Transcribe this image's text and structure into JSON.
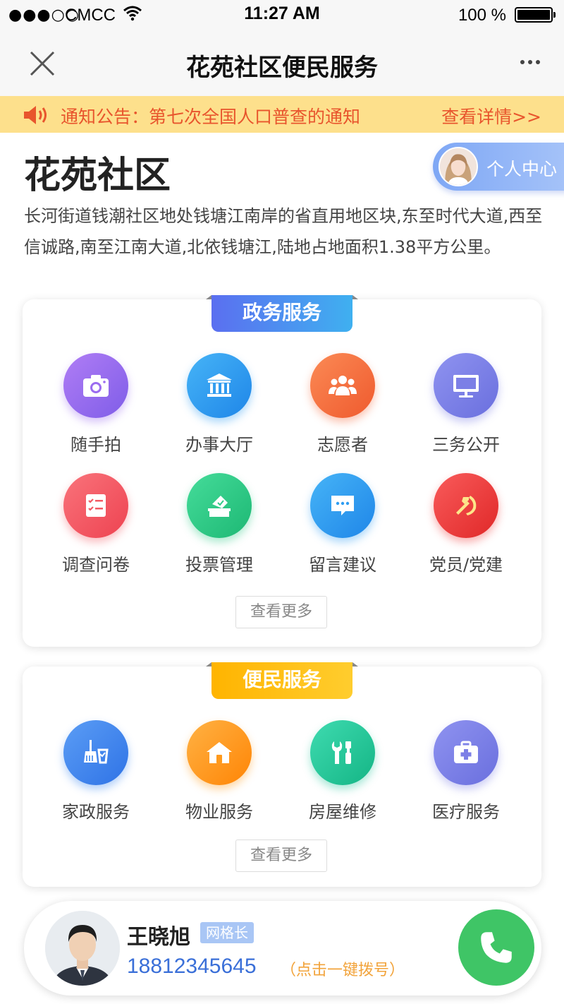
{
  "status_bar": {
    "signal": "●●●○○",
    "carrier": "CMCC",
    "time": "11:27 AM",
    "battery_text": "100 %"
  },
  "navbar": {
    "title": "花苑社区便民服务"
  },
  "notice": {
    "text": "通知公告：第七次全国人口普查的通知",
    "detail_link": "查看详情>>"
  },
  "community": {
    "name": "花苑社区",
    "personal_center": "个人中心",
    "description": "长河街道钱潮社区地处钱塘江南岸的省直用地区块,东至时代大道,西至信诚路,南至江南大道,北依钱塘江,陆地占地面积1.38平方公里。"
  },
  "gov_services": {
    "title": "政务服务",
    "more": "查看更多",
    "items": [
      {
        "label": "随手拍",
        "icon": "camera-icon",
        "color": "#9b6cf0"
      },
      {
        "label": "办事大厅",
        "icon": "government-building-icon",
        "color": "#2f9df2"
      },
      {
        "label": "志愿者",
        "icon": "people-group-icon",
        "color": "#f46a3c"
      },
      {
        "label": "三务公开",
        "icon": "monitor-icon",
        "color": "#7c7fe6"
      },
      {
        "label": "调查问卷",
        "icon": "checklist-icon",
        "color": "#f35a63"
      },
      {
        "label": "投票管理",
        "icon": "ballot-box-icon",
        "color": "#2fcb86"
      },
      {
        "label": "留言建议",
        "icon": "chat-bubble-icon",
        "color": "#2f9df2"
      },
      {
        "label": "党员/党建",
        "icon": "party-emblem-icon",
        "color": "#f03a3a"
      }
    ]
  },
  "life_services": {
    "title": "便民服务",
    "more": "查看更多",
    "items": [
      {
        "label": "家政服务",
        "icon": "broom-bucket-icon",
        "color": "#3c86ef"
      },
      {
        "label": "物业服务",
        "icon": "house-icon",
        "color": "#ff9a1c"
      },
      {
        "label": "房屋维修",
        "icon": "wrench-screwdriver-icon",
        "color": "#22c59a"
      },
      {
        "label": "医疗服务",
        "icon": "medical-kit-icon",
        "color": "#7c7fe6"
      }
    ]
  },
  "contact": {
    "name": "王晓旭",
    "role": "网格长",
    "phone": "18812345645",
    "hint": "（点击一键拨号）"
  }
}
